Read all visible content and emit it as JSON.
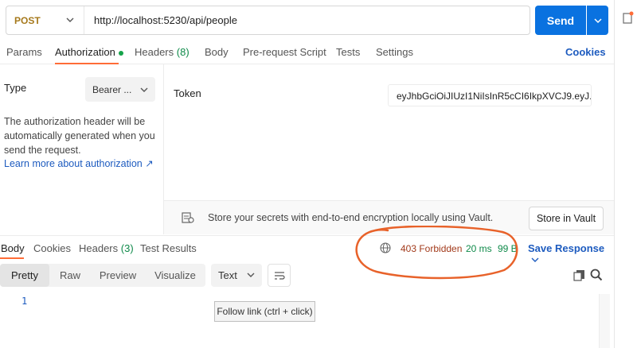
{
  "request": {
    "method": "POST",
    "url": "http://localhost:5230/api/people",
    "send_label": "Send"
  },
  "request_tabs": [
    {
      "label": "Params"
    },
    {
      "label": "Authorization"
    },
    {
      "label": "Headers",
      "count": "(8)"
    },
    {
      "label": "Body"
    },
    {
      "label": "Pre-request Script"
    },
    {
      "label": "Tests"
    },
    {
      "label": "Settings"
    }
  ],
  "cookies_label": "Cookies",
  "auth": {
    "type_label": "Type",
    "type_value": "Bearer ...",
    "description": "The authorization header will be automatically generated when you send the request.",
    "learn_link": "Learn more about authorization ↗",
    "token_label": "Token",
    "token_value": "eyJhbGciOiJIUzI1NiIsInR5cCI6IkpXVCJ9.eyJ..."
  },
  "vault": {
    "message": "Store your secrets with end-to-end encryption locally using Vault.",
    "button": "Store in Vault"
  },
  "response_tabs": [
    {
      "label": "Body"
    },
    {
      "label": "Cookies"
    },
    {
      "label": "Headers",
      "count": "(3)"
    },
    {
      "label": "Test Results"
    }
  ],
  "response": {
    "status": "403 Forbidden",
    "time": "20 ms",
    "size": "99 B",
    "save_label": "Save Response"
  },
  "view_modes": [
    "Pretty",
    "Raw",
    "Preview",
    "Visualize"
  ],
  "format": "Text",
  "body_line_number": "1",
  "tooltip": "Follow link (ctrl + click)",
  "colors": {
    "accent": "#ff6c37",
    "send": "#0a72e0",
    "annotation": "#e8622a"
  }
}
